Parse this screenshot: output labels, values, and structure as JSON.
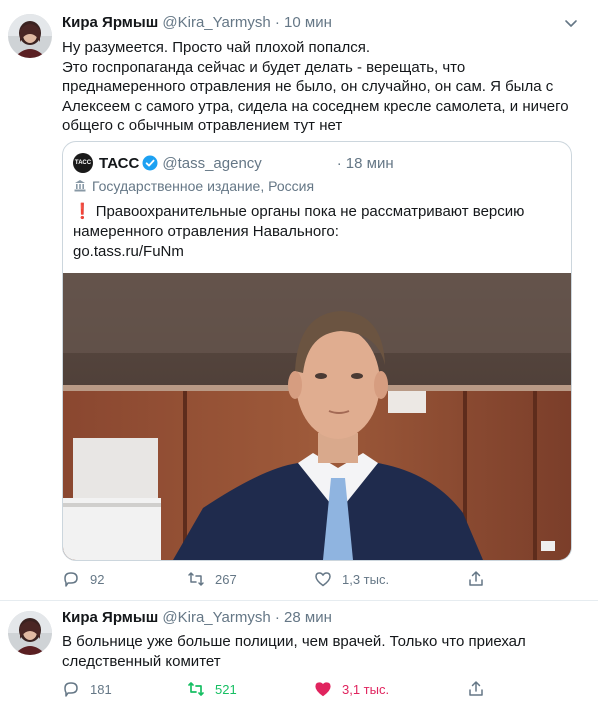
{
  "tweet1": {
    "name": "Кира Ярмыш",
    "handle": "@Kira_Yarmysh",
    "dot": "·",
    "time": "10 мин",
    "lines": [
      "Ну разумеется. Просто чай плохой попался.",
      "Это госпропаганда сейчас и будет делать - верещать, что",
      "преднамеренного отравления не было, он случайно, он сам. Я была с",
      "Алексеем с самого утра, сидела на соседнем кресле самолета, и ничего",
      "общего с обычным отравлением тут нет"
    ],
    "quote": {
      "logo_text": "ТАСС",
      "name": "ТАСС",
      "handle": "@tass_agency",
      "dot": "·",
      "time": "18 мин",
      "label": "Государственное издание, Россия",
      "lines": [
        "Правоохранительные органы пока не рассматривают версию",
        "намеренного отравления Навального:",
        "go.tass.ru/FuNm"
      ]
    },
    "actions": {
      "replies": "92",
      "retweets": "267",
      "likes": "1,3 тыс."
    }
  },
  "tweet2": {
    "name": "Кира Ярмыш",
    "handle": "@Kira_Yarmysh",
    "dot": "·",
    "time": "28 мин",
    "lines": [
      "В больнице уже больше полиции, чем врачей. Только что приехал",
      "следственный комитет"
    ],
    "actions": {
      "replies": "181",
      "retweets": "521",
      "likes": "3,1 тыс."
    }
  },
  "colors": {
    "text": "#14171a",
    "muted": "#657786",
    "border": "#ccd6dd",
    "verified": "#1da1f2",
    "retweet_active": "#17bf63",
    "like_active": "#e0245e"
  }
}
